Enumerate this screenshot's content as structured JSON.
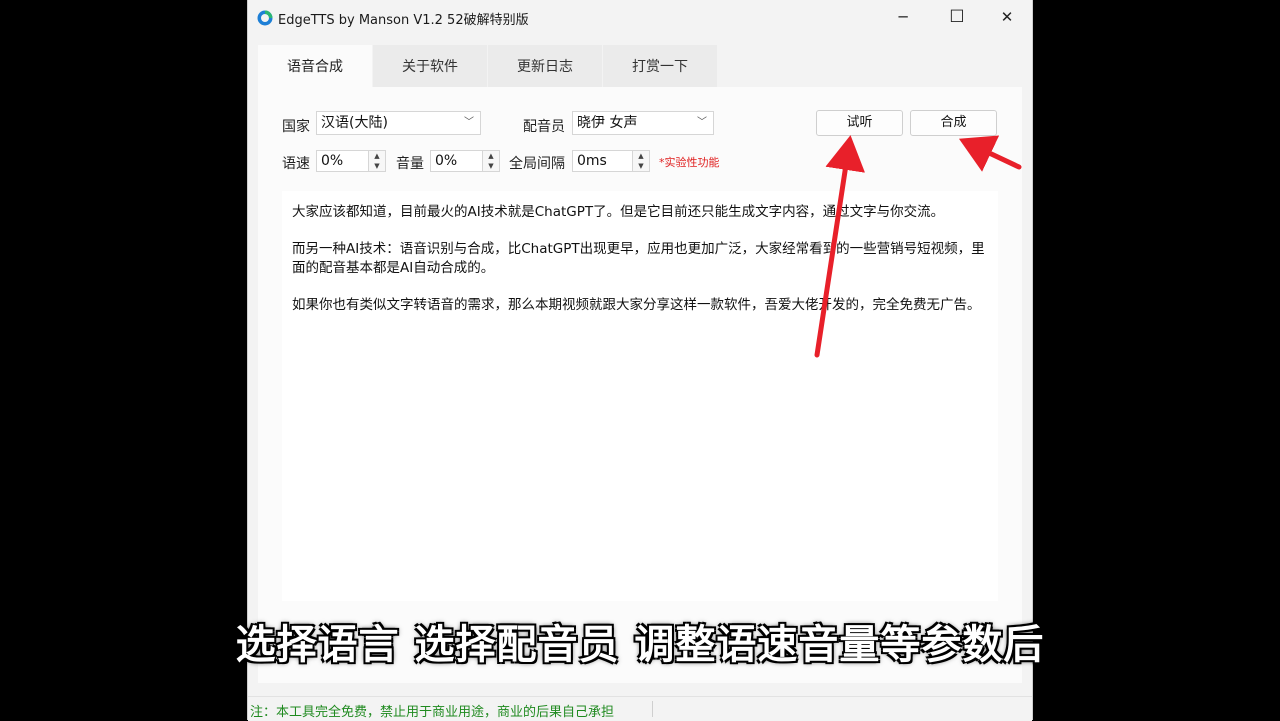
{
  "window": {
    "title": "EdgeTTS by Manson V1.2 52破解特别版",
    "icon_label": "TTS",
    "minimize_glyph": "─",
    "maximize_glyph": "☐",
    "close_glyph": "✕"
  },
  "tabs": [
    {
      "label": "语音合成",
      "active": true
    },
    {
      "label": "关于软件",
      "active": false
    },
    {
      "label": "更新日志",
      "active": false
    },
    {
      "label": "打赏一下",
      "active": false
    }
  ],
  "form": {
    "country_label": "国家",
    "country_value": "汉语(大陆)",
    "voice_label": "配音员",
    "voice_value": "晓伊 女声",
    "preview_button": "试听",
    "synthesize_button": "合成",
    "rate_label": "语速",
    "rate_value": "0%",
    "volume_label": "音量",
    "volume_value": "0%",
    "gap_label": "全局间隔",
    "gap_value": "0ms",
    "experimental_note": "*实验性功能"
  },
  "editor": {
    "paragraphs": [
      "大家应该都知道，目前最火的AI技术就是ChatGPT了。但是它目前还只能生成文字内容，通过文字与你交流。",
      "而另一种AI技术：语音识别与合成，比ChatGPT出现更早，应用也更加广泛，大家经常看到的一些营销号短视频，里面的配音基本都是AI自动合成的。",
      "如果你也有类似文字转语音的需求，那么本期视频就跟大家分享这样一款软件，吾爱大佬开发的，完全免费无广告。"
    ]
  },
  "status": {
    "text": "注：本工具完全免费，禁止用于商业用途，商业的后果自己承担"
  },
  "video_subtitle": "选择语言 选择配音员 调整语速音量等参数后",
  "colors": {
    "arrow": "#e8202a",
    "status_text": "#1f8a1f",
    "experimental": "#e02020"
  }
}
